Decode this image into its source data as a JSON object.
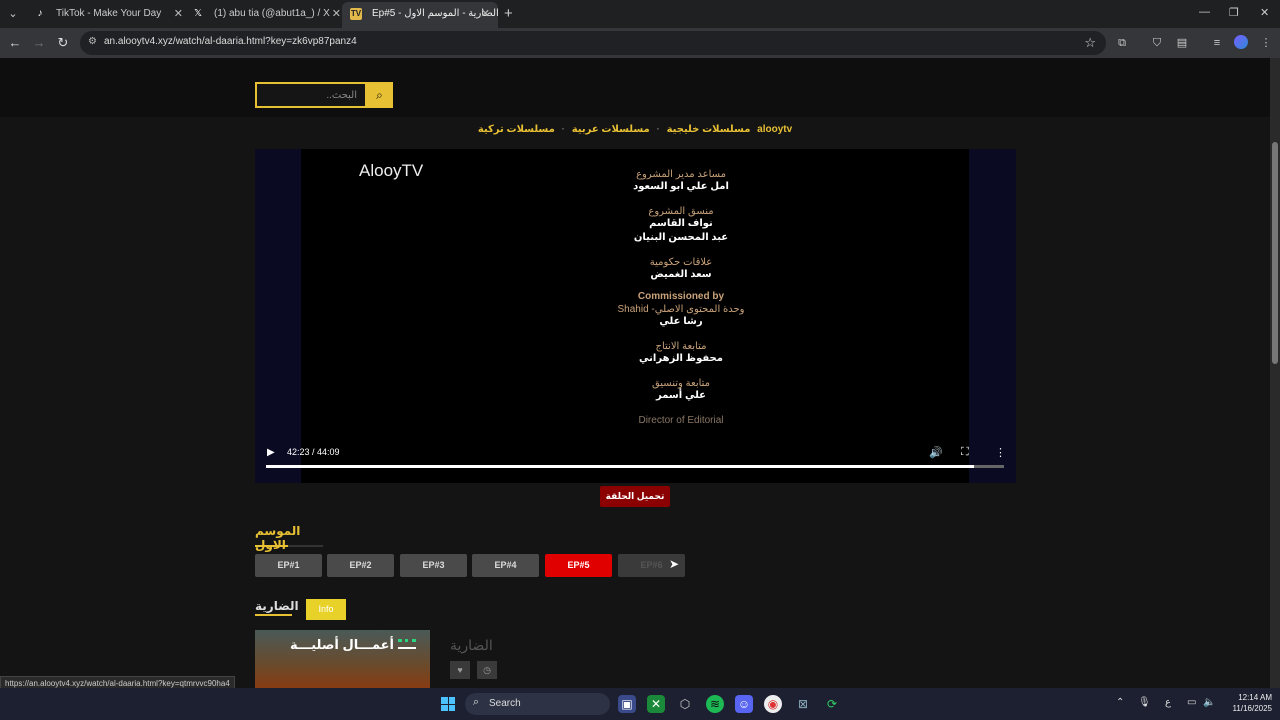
{
  "browser": {
    "tabs": [
      {
        "title": "TikTok - Make Your Day",
        "favicon": "tiktok-icon"
      },
      {
        "title": "(1) abu tia (@abut1a_) / X",
        "favicon": "x-icon"
      },
      {
        "title": "Ep#5 - الضارية - الموسم الاول",
        "favicon": "site-icon",
        "active": true
      }
    ],
    "url": "an.alooytv4.xyz/watch/al-daaria.html?key=zk6vp87panz4",
    "status_url": "https://an.alooytv4.xyz/watch/al-daaria.html?key=qtmrvvc90ha4"
  },
  "page": {
    "search_placeholder": "البحث..",
    "nav_links": [
      "alooytv",
      "مسلسلات خليجية",
      "مسلسلات عربية",
      "مسلسلات تركية"
    ],
    "video": {
      "watermark": "AlooyTV",
      "credits": [
        {
          "role": "مساعد مدير المشروع",
          "names": [
            "امل علي ابو السعود"
          ]
        },
        {
          "role": "منسق المشروع",
          "names": [
            "نواف القاسم",
            "عبد المحسن البنيان"
          ]
        },
        {
          "role": "علاقات حكومية",
          "names": [
            "سعد الغميض"
          ]
        },
        {
          "role": "Commissioned by",
          "names": []
        },
        {
          "role": "Shahid -وحدة المحتوى الاصلي",
          "names": [
            "رشا علي"
          ]
        },
        {
          "role": "متابعة الانتاج",
          "names": [
            "محفوظ الزهراني"
          ]
        },
        {
          "role": "متابعة وتنسيق",
          "names": [
            "علي أسمر"
          ]
        },
        {
          "role": "Director of Editorial",
          "names": []
        }
      ],
      "current_time": "42:23",
      "duration": "44:09",
      "time_display": "42:23 / 44:09",
      "progress": 0.96
    },
    "download_label": "تحميل الحلقة",
    "season_title": "الموسم الاول",
    "episodes": [
      "EP#1",
      "EP#2",
      "EP#3",
      "EP#4",
      "EP#5",
      "EP#6"
    ],
    "active_episode": "EP#5",
    "show_title": "الضارية",
    "info_label": "Info",
    "poster_text": "أعمـــال أصليـــة",
    "show_subtitle": "الضارية"
  },
  "taskbar": {
    "search_label": "Search",
    "time": "12:14 AM",
    "date": "11/16/2025",
    "lang": "ع"
  },
  "colors": {
    "accent": "#e8c034",
    "active_episode": "#e00000",
    "download": "#8b0000"
  }
}
